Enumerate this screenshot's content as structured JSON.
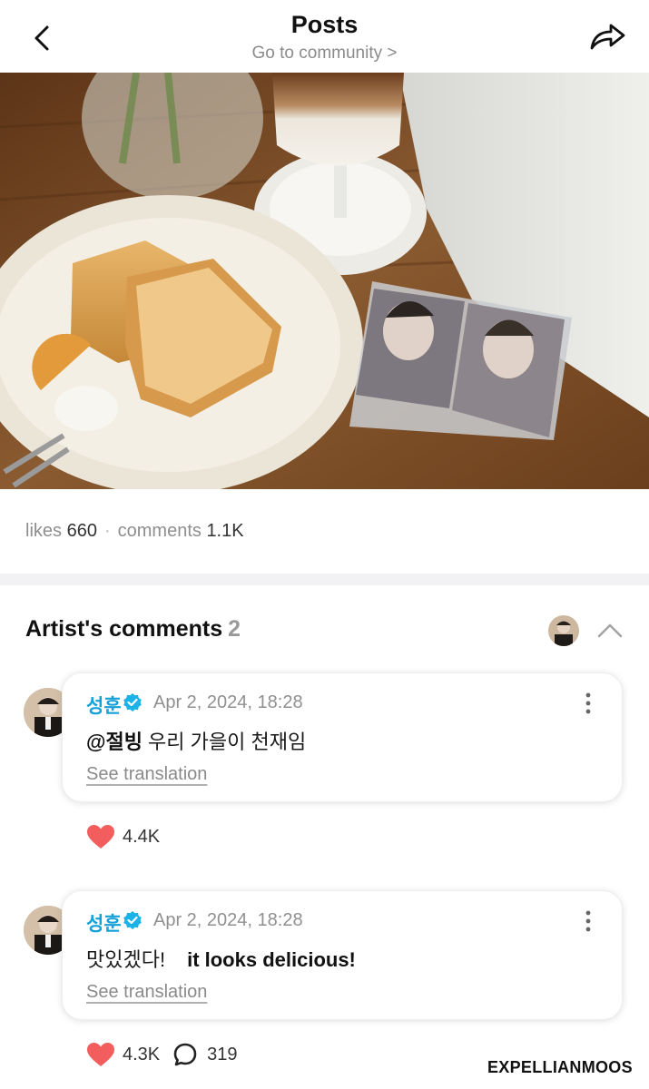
{
  "header": {
    "title": "Posts",
    "subtitle": "Go to community >"
  },
  "post": {
    "photo_icon": "photo-food-cake-coffee",
    "stats": {
      "likes_label": "likes",
      "likes_value": "660",
      "separator": "·",
      "comments_label": "comments",
      "comments_value": "1.1K"
    }
  },
  "artist_comments": {
    "title": "Artist's comments",
    "count": "2",
    "comments": [
      {
        "author": "성훈",
        "date": "Apr 2, 2024, 18:28",
        "mention": "@절빙",
        "text": " 우리 가을이 천재임",
        "translation": "",
        "see_translation": "See translation",
        "likes": "4.4K",
        "replies": ""
      },
      {
        "author": "성훈",
        "date": "Apr 2, 2024, 18:28",
        "mention": "",
        "text": "맛있겠다!",
        "translation": "it looks delicious!",
        "see_translation": "See translation",
        "likes": "4.3K",
        "replies": "319"
      }
    ]
  },
  "watermark": "EXPELLIANMOOS",
  "colors": {
    "accent_name": "#16a0d8",
    "verified_badge": "#1ab2e8",
    "heart": "#f25d5d",
    "muted_text": "#8e8e8e",
    "divider": "#f2f2f4"
  }
}
